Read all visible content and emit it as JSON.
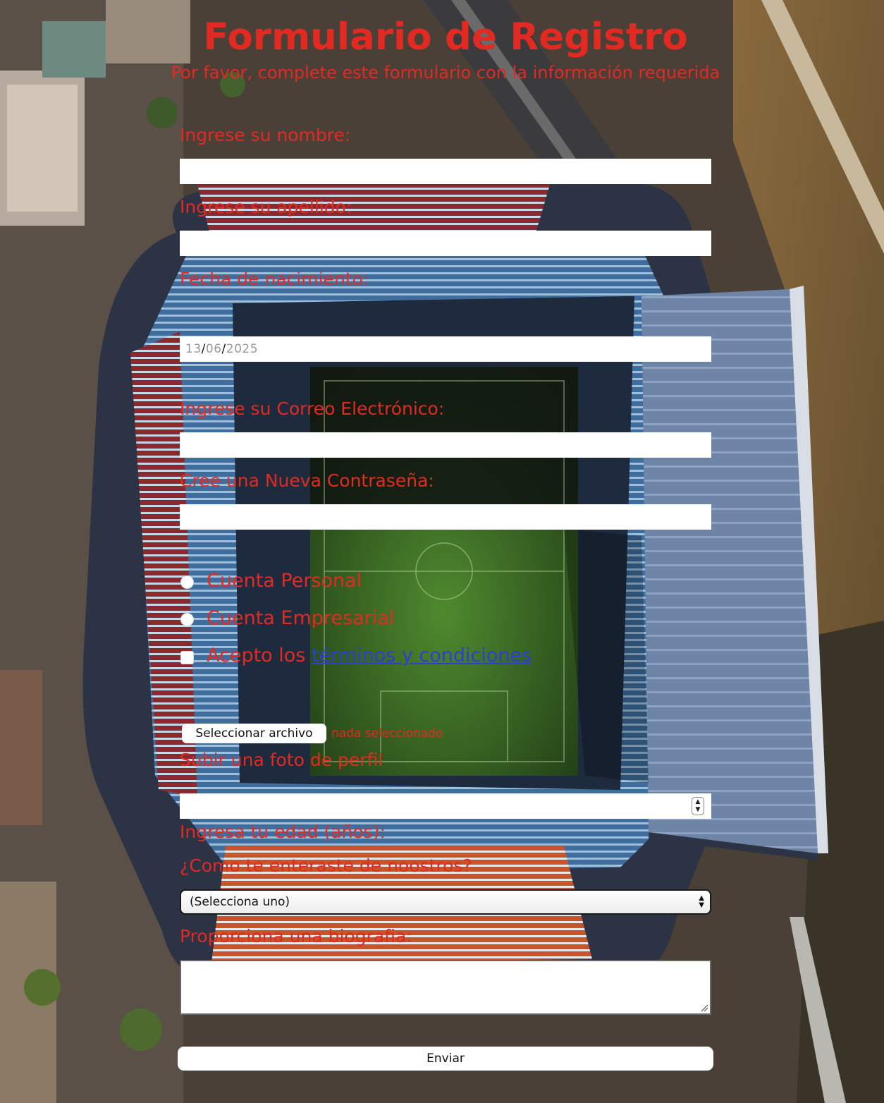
{
  "header": {
    "title": "Formulario de Registro",
    "subtitle": "Por favor, complete este formulario con la información requerida"
  },
  "form": {
    "first_name_label": "Ingrese su nombre:",
    "last_name_label": "Ingrese su apellido:",
    "birthdate_label": "Fecha de nacimiento:",
    "birthdate": {
      "day": "13",
      "month": "06",
      "year": "2025",
      "separator": "/"
    },
    "email_label": "Ingrese su Correo Electrónico:",
    "password_label": "Cree una Nueva Contraseña:",
    "account_personal": "Cuenta Personal",
    "account_business": "Cuenta Empresarial",
    "terms_prefix": "Acepto los",
    "terms_link": "términos y condiciones",
    "file_button": "Seleccionar archivo",
    "file_status": "nada seleccionado",
    "photo_label": "Subir una foto de perfil",
    "age_label": "Ingresa tu edad (años):",
    "source_label": "¿Como te enteraste de noostros?",
    "source_selected": "(Selecciona uno)",
    "bio_label": "Proporciona una biografia:",
    "submit_label": "Enviar"
  },
  "colors": {
    "accent": "#e32a22",
    "link": "#2a3fd8"
  },
  "icons": {
    "stepper": "number-stepper-icon",
    "select_arrows": "select-arrows-icon",
    "resize": "resize-grip-icon"
  }
}
